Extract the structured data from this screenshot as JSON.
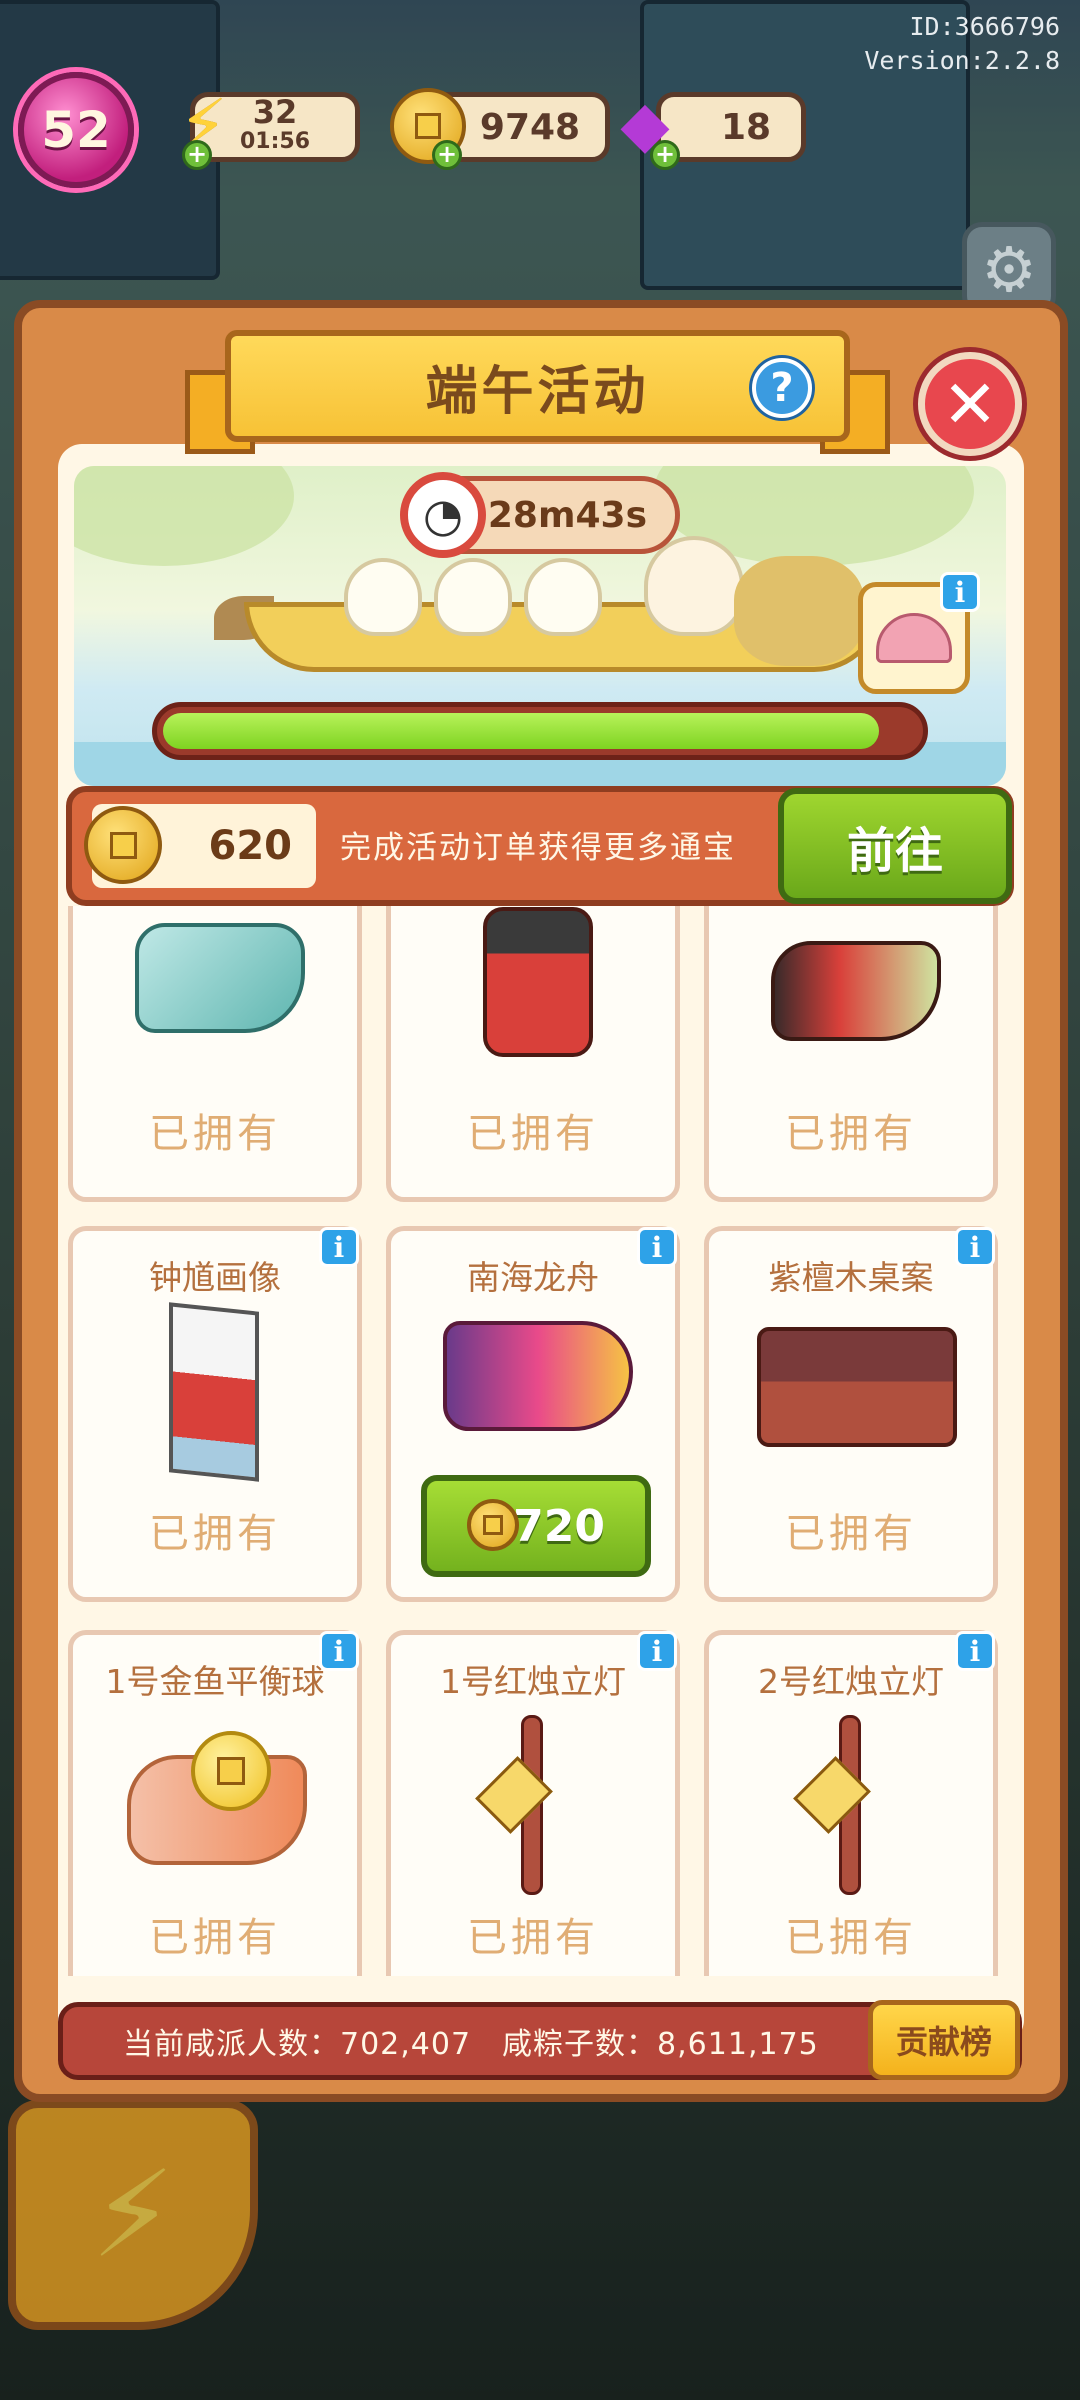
{
  "header": {
    "id": "ID:3666796",
    "version": "Version:2.2.8"
  },
  "hud": {
    "level": "52",
    "energy": "32",
    "energy_timer": "01:56",
    "coins": "9748",
    "gems": "18"
  },
  "panel": {
    "title": "端午活动",
    "timer": "28m43s",
    "progress_fraction": 0.95
  },
  "coinbar": {
    "coins": "620",
    "hint": "完成活动订单获得更多通宝",
    "go_label": "前往"
  },
  "items": [
    {
      "name": "",
      "status": "已拥有"
    },
    {
      "name": "",
      "status": "已拥有"
    },
    {
      "name": "",
      "status": "已拥有"
    },
    {
      "name": "钟馗画像",
      "status": "已拥有"
    },
    {
      "name": "南海龙舟",
      "price": "720"
    },
    {
      "name": "紫檀木桌案",
      "status": "已拥有"
    },
    {
      "name": "1号金鱼平衡球",
      "status": "已拥有"
    },
    {
      "name": "1号红烛立灯",
      "status": "已拥有"
    },
    {
      "name": "2号红烛立灯",
      "status": "已拥有"
    }
  ],
  "footer": {
    "stats": "当前咸派人数：702,407　咸粽子数：8,611,175",
    "rank_label": "贡献榜"
  },
  "icons": {
    "close": "close-icon",
    "help": "help-icon",
    "clock": "clock-icon",
    "info": "info-icon",
    "coin": "coin-icon",
    "settings": "gear-icon",
    "energy": "bolt-icon",
    "gem": "gem-icon"
  }
}
